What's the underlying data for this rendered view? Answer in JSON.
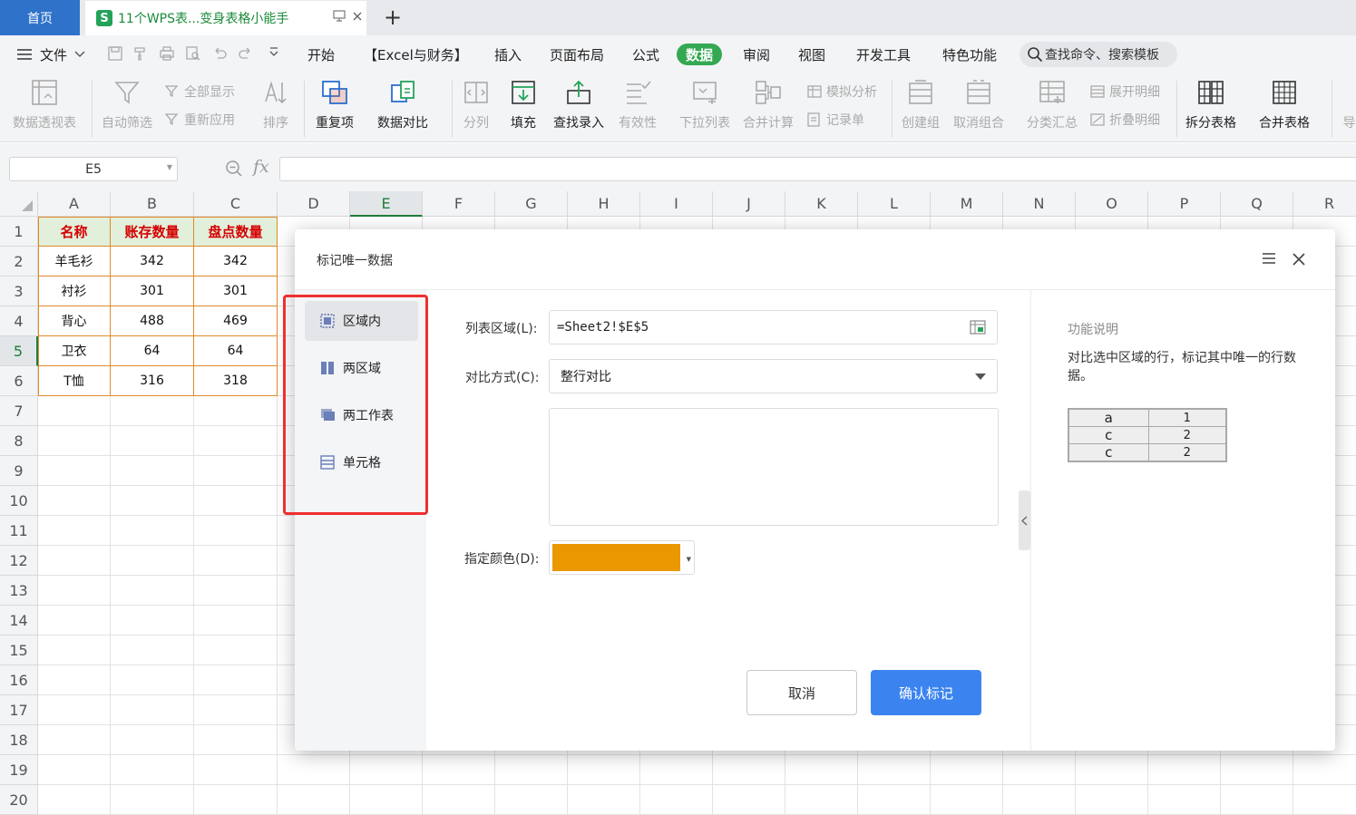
{
  "titlebar": {
    "home_tab": "首页",
    "doc_tab_icon": "S",
    "doc_tab_title": "11个WPS表...变身表格小能手",
    "new_tab": "+"
  },
  "menubar": {
    "file_menu": "文件",
    "items": [
      "开始",
      "【Excel与财务】",
      "插入",
      "页面布局",
      "公式",
      "数据",
      "审阅",
      "视图",
      "开发工具",
      "特色功能"
    ],
    "active_item": "数据",
    "search_placeholder": "查找命令、搜索模板"
  },
  "ribbon": {
    "pivot": "数据透视表",
    "autofilter": "自动筛选",
    "show_all": "全部显示",
    "reapply": "重新应用",
    "sort": "排序",
    "duplicates": "重复项",
    "compare": "数据对比",
    "split_col": "分列",
    "fill": "填充",
    "find_entry": "查找录入",
    "validity": "有效性",
    "dropdown_list": "下拉列表",
    "consolidate": "合并计算",
    "what_if": "模拟分析",
    "record_form": "记录单",
    "group": "创建组",
    "ungroup": "取消组合",
    "subtotal": "分类汇总",
    "expand_detail": "展开明细",
    "collapse_detail": "折叠明细",
    "split_table": "拆分表格",
    "merge_table": "合并表格",
    "more": "导"
  },
  "formula_bar": {
    "name_box": "E5",
    "fx": "fx",
    "formula": ""
  },
  "sheet": {
    "columns": [
      "A",
      "B",
      "C",
      "D",
      "E",
      "F",
      "G",
      "H",
      "I",
      "J",
      "K",
      "L",
      "M",
      "N",
      "O",
      "P",
      "Q",
      "R"
    ],
    "rows": [
      "1",
      "2",
      "3",
      "4",
      "5",
      "6",
      "7",
      "8",
      "9",
      "10",
      "11",
      "12",
      "13",
      "14",
      "15",
      "16",
      "17",
      "18",
      "19",
      "20"
    ],
    "active_column": "E",
    "active_row": "5",
    "headers": [
      "名称",
      "账存数量",
      "盘点数量"
    ],
    "data": [
      [
        "羊毛衫",
        "342",
        "342"
      ],
      [
        "衬衫",
        "301",
        "301"
      ],
      [
        "背心",
        "488",
        "469"
      ],
      [
        "卫衣",
        "64",
        "64"
      ],
      [
        "T恤",
        "316",
        "318"
      ]
    ]
  },
  "dialog": {
    "title": "标记唯一数据",
    "nav": [
      "区域内",
      "两区域",
      "两工作表",
      "单元格"
    ],
    "active_nav": "区域内",
    "range_label": "列表区域(L):",
    "range_value": "=Sheet2!$E$5",
    "compare_label": "对比方式(C):",
    "compare_value": "整行对比",
    "color_label": "指定颜色(D):",
    "color_value": "#eb9700",
    "cancel": "取消",
    "confirm": "确认标记",
    "desc_title": "功能说明",
    "desc_text": "对比选中区域的行，标记其中唯一的行数据。",
    "example": [
      [
        "a",
        "1"
      ],
      [
        "c",
        "2"
      ],
      [
        "c",
        "2"
      ]
    ],
    "highlight_color": "#ef2f2f",
    "confirm_color": "#3b84f0"
  }
}
